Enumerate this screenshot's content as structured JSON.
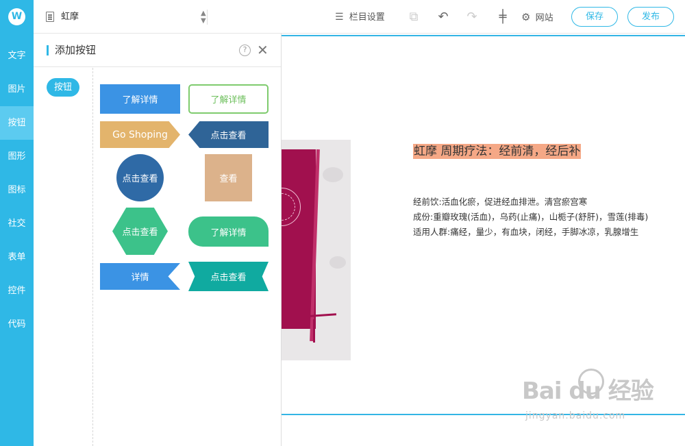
{
  "app": {
    "logo": "W"
  },
  "rail": {
    "items": [
      "文字",
      "图片",
      "按钮",
      "图形",
      "图标",
      "社交",
      "表单",
      "控件",
      "代码"
    ],
    "active_index": 2
  },
  "topbar": {
    "page_name": "虹摩",
    "column_settings": "栏目设置",
    "site": "网站",
    "save": "保存",
    "publish": "发布",
    "icons": [
      "document-icon",
      "sort-updown-icon",
      "list-icon",
      "paste-icon",
      "undo-icon",
      "redo-icon",
      "insert-line-icon",
      "gear-icon"
    ]
  },
  "panel": {
    "title": "添加按钮",
    "help": "?",
    "category": "按钮",
    "samples": [
      "了解详情",
      "了解详情",
      "Go Shoping",
      "点击查看",
      "点击查看",
      "查看",
      "点击查看",
      "了解详情",
      "详情",
      "点击查看"
    ]
  },
  "canvas": {
    "headline": "虹摩 周期疗法：经前清，经后补",
    "lines": [
      "经前饮:活血化瘀，促进经血排泄。清宫瘀宫寒",
      "成份:重瓣玫瑰(活血)，乌药(止痛)，山栀子(舒肝)，雪莲(排毒)",
      "适用人群:痛经，量少，有血块，闭经，手脚冰凉，乳腺增生"
    ]
  },
  "watermark": {
    "brand": "Bai  du 经验",
    "url": "jingyan.baidu.com"
  },
  "colors": {
    "accent": "#2fb8e6",
    "headline_bg": "#f5a886",
    "book": "#a1104e"
  }
}
